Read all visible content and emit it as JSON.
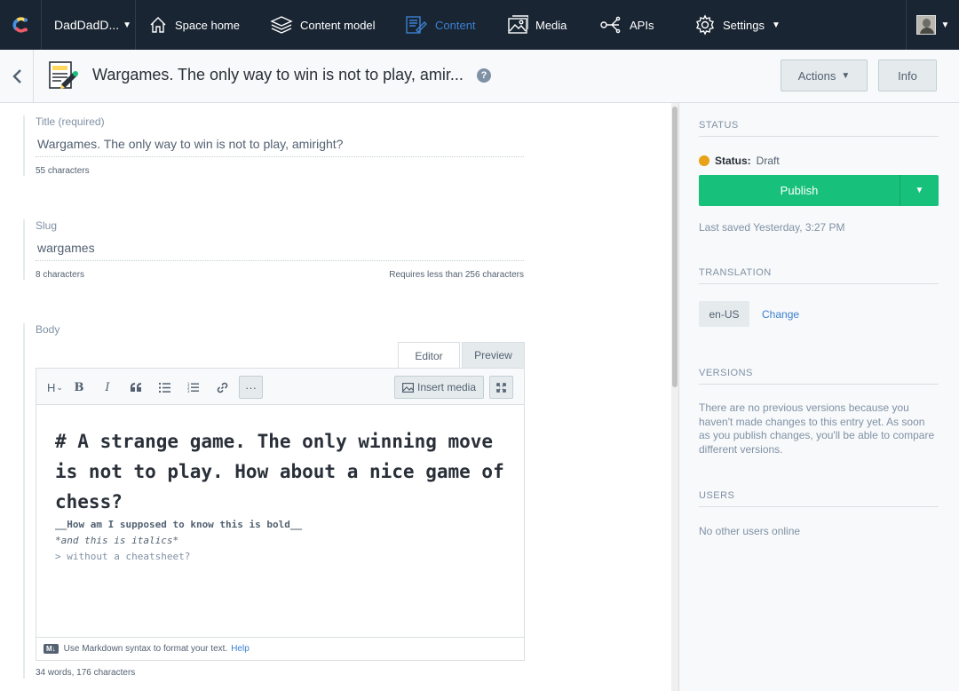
{
  "nav": {
    "space_name": "DadDadD...",
    "items": [
      {
        "label": "Space home",
        "icon": "home-icon"
      },
      {
        "label": "Content model",
        "icon": "layers-icon"
      },
      {
        "label": "Content",
        "icon": "content-icon",
        "active": true
      },
      {
        "label": "Media",
        "icon": "media-icon"
      },
      {
        "label": "APIs",
        "icon": "api-icon"
      },
      {
        "label": "Settings",
        "icon": "gear-icon"
      }
    ]
  },
  "header": {
    "title": "Wargames. The only way to win is not to play, amir...",
    "help": "?",
    "actions_label": "Actions",
    "info_label": "Info"
  },
  "fields": {
    "title": {
      "label": "Title (required)",
      "value": "Wargames. The only way to win is not to play, amiright?",
      "counter": "55 characters"
    },
    "slug": {
      "label": "Slug",
      "value": "wargames",
      "counter": "8 characters",
      "limit": "Requires less than 256 characters"
    },
    "body": {
      "label": "Body"
    }
  },
  "editor": {
    "tab_editor": "Editor",
    "tab_preview": "Preview",
    "toolbar": {
      "heading": "H",
      "bold": "B",
      "italic": "I",
      "more": "···",
      "insert_media": "Insert media"
    },
    "content": {
      "heading": "# A strange game. The only winning move is not to play. How about a nice game of chess?",
      "bold_line": "__How am I supposed to know this is bold__",
      "italic_line": "*and this is italics*",
      "quote_line": "> without a cheatsheet?"
    },
    "footer": {
      "badge": "M↓",
      "text": "Use Markdown syntax to format your text.",
      "help": "Help"
    },
    "wordcount": "34 words, 176 characters"
  },
  "sidebar": {
    "status_heading": "STATUS",
    "status_label": "Status:",
    "status_value": "Draft",
    "publish_label": "Publish",
    "last_saved": "Last saved Yesterday, 3:27 PM",
    "translation_heading": "TRANSLATION",
    "locale": "en-US",
    "change_label": "Change",
    "versions_heading": "VERSIONS",
    "versions_text": "There are no previous versions because you haven't made changes to this entry yet. As soon as you publish changes, you'll be able to compare different versions.",
    "users_heading": "USERS",
    "users_text": "No other users online"
  },
  "colors": {
    "nav_bg": "#192532",
    "accent": "#3c80cf",
    "publish": "#17c17b",
    "draft": "#e8a217"
  }
}
